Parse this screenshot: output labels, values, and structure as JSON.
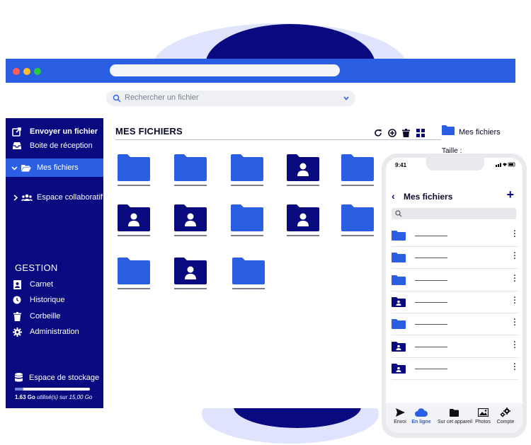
{
  "colors": {
    "brand": "#0a0a80",
    "accent": "#2b5fe3",
    "titlebar": "#2b5fe3"
  },
  "browser": {
    "dots": [
      "#ff5f57",
      "#febc2e",
      "#28c840"
    ]
  },
  "search": {
    "placeholder": "Rechercher un fichier"
  },
  "sidebar": {
    "items": [
      {
        "label": "Envoyer un fichier",
        "icon": "upload-icon",
        "bold": true
      },
      {
        "label": "Boite de réception",
        "icon": "inbox-icon"
      },
      {
        "label": "Mes fichiers",
        "icon": "folder-open-icon",
        "active": true
      },
      {
        "label": "Espace collaboratif",
        "icon": "users-icon"
      }
    ],
    "gestion": {
      "title": "GESTION",
      "items": [
        {
          "label": "Carnet",
          "icon": "contacts-book-icon"
        },
        {
          "label": "Historique",
          "icon": "clock-icon"
        },
        {
          "label": "Corbeille",
          "icon": "trash-icon"
        },
        {
          "label": "Administration",
          "icon": "gear-icon"
        }
      ]
    },
    "storage": {
      "title": "Espace de stockage",
      "used": "1.63 Go",
      "used_suffix": " utilisé(s) sur 15,00 Go",
      "fraction": 0.109
    }
  },
  "main": {
    "title": "MES FICHIERS",
    "toolbar": [
      "refresh-icon",
      "add-circle-icon",
      "trash-icon",
      "grid-view-icon"
    ],
    "folders": [
      {
        "shared": false
      },
      {
        "shared": false
      },
      {
        "shared": false
      },
      {
        "shared": true
      },
      {
        "shared": false
      },
      {
        "shared": true
      },
      {
        "shared": true
      },
      {
        "shared": false
      },
      {
        "shared": true
      },
      {
        "shared": false
      },
      {
        "shared": false
      },
      {
        "shared": true
      },
      {
        "shared": false
      }
    ]
  },
  "details": {
    "name": "Mes fichiers",
    "size_label": "Taille :"
  },
  "phone": {
    "time": "9:41",
    "title": "Mes fichiers",
    "rows": [
      {
        "shared": false
      },
      {
        "shared": false
      },
      {
        "shared": false
      },
      {
        "shared": true
      },
      {
        "shared": false
      },
      {
        "shared": true
      },
      {
        "shared": true
      }
    ],
    "tabs": [
      {
        "label": "Envoi",
        "icon": "send-icon"
      },
      {
        "label": "En ligne",
        "icon": "cloud-icon",
        "active": true
      },
      {
        "label": "Sur cet appareil",
        "icon": "device-folder-icon"
      },
      {
        "label": "Photos",
        "icon": "photos-icon"
      },
      {
        "label": "Compte",
        "icon": "account-gear-icon"
      }
    ]
  }
}
